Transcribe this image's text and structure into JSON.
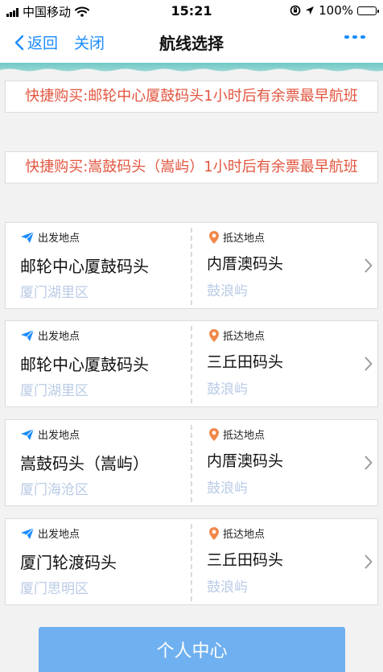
{
  "status_bar": {
    "carrier": "中国移动",
    "time": "15:21",
    "battery": "100%"
  },
  "nav": {
    "back_label": "返回",
    "close_label": "关闭",
    "title": "航线选择",
    "more_icon": "more-dots-icon"
  },
  "notices": [
    {
      "text": "快捷购买:邮轮中心厦鼓码头1小时后有余票最早航班"
    },
    {
      "text": "快捷购买:嵩鼓码头（嵩屿）1小时后有余票最早航班"
    }
  ],
  "routes": [
    {
      "departure_label": "出发地点",
      "departure": "邮轮中心厦鼓码头",
      "departure_area": "厦门湖里区",
      "arrival_label": "抵达地点",
      "arrival": "内厝澳码头",
      "arrival_area": "鼓浪屿"
    },
    {
      "departure_label": "出发地点",
      "departure": "邮轮中心厦鼓码头",
      "departure_area": "厦门湖里区",
      "arrival_label": "抵达地点",
      "arrival": "三丘田码头",
      "arrival_area": "鼓浪屿"
    },
    {
      "departure_label": "出发地点",
      "departure": "嵩鼓码头（嵩屿）",
      "departure_area": "厦门海沧区",
      "arrival_label": "抵达地点",
      "arrival": "内厝澳码头",
      "arrival_area": "鼓浪屿"
    },
    {
      "departure_label": "出发地点",
      "departure": "厦门轮渡码头",
      "departure_area": "厦门思明区",
      "arrival_label": "抵达地点",
      "arrival": "三丘田码头",
      "arrival_area": "鼓浪屿"
    }
  ],
  "bottom_button": {
    "label": "个人中心"
  },
  "colors": {
    "accent": "#1a8cff",
    "notice_text": "#e2553f",
    "area_text": "#b9cbe6",
    "button_bg": "#6fb0f0",
    "pin": "#f0884a"
  }
}
